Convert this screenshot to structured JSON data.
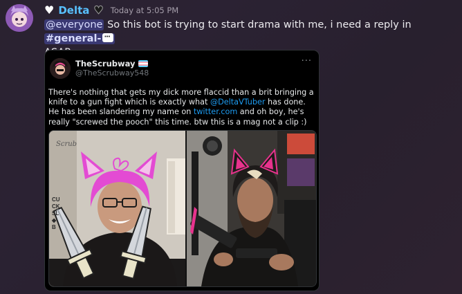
{
  "message": {
    "username": "Delta",
    "timestamp": "Today at 5:05 PM",
    "mention": "@everyone",
    "text_before_channel": "So this bot is trying to start drama with me, i need a reply in",
    "channel": "#general-",
    "text_after_channel": "ASAP"
  },
  "tweet": {
    "display_name": "TheScrubway",
    "handle": "@TheScrubway548",
    "text_part1": "There's nothing that gets my dick more flaccid than a brit bringing a knife to a gun fight which is exactly what",
    "mention": "@DeltaVTuber",
    "text_part2": "has done. He has been slandering my name on",
    "link": "twitter.com",
    "text_part3": "and oh boy, he's really \"screwed the pooch\" this time. btw this is a mag not a clip :)",
    "more": "···",
    "media_signature": "Scrub",
    "poster_letters": "CU\nCK\nSL\n◆\nB"
  },
  "colors": {
    "username": "#58c0ff",
    "mention_bg": "#5865f2",
    "link": "#1d9bf0"
  }
}
